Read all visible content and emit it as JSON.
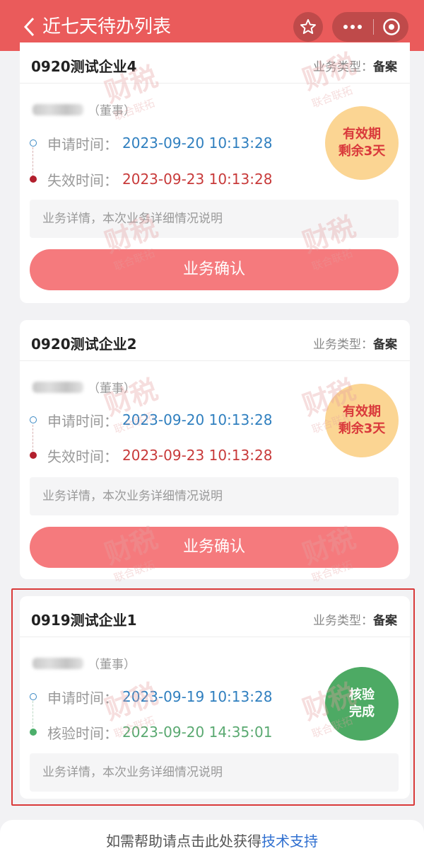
{
  "header": {
    "title": "近七天待办列表",
    "icons": {
      "back": "chevron-left-icon",
      "star": "star-icon",
      "more": "more-dots-icon",
      "close": "target-close-icon"
    },
    "accent": "#ea5b5b"
  },
  "cards": [
    {
      "company": "0920测试企业4",
      "type_label": "业务类型：",
      "type_value": "备案",
      "role": "（董事）",
      "apply_label": "申请时间：",
      "apply_time": "2023-09-20 10:13:28",
      "second_label": "失效时间：",
      "second_time": "2023-09-23 10:13:28",
      "badge_line1": "有效期",
      "badge_line2": "剩余3天",
      "detail": "业务详情，本次业务详细情况说明",
      "button": "业务确认"
    },
    {
      "company": "0920测试企业2",
      "type_label": "业务类型：",
      "type_value": "备案",
      "role": "（董事）",
      "apply_label": "申请时间：",
      "apply_time": "2023-09-20 10:13:28",
      "second_label": "失效时间：",
      "second_time": "2023-09-23 10:13:28",
      "badge_line1": "有效期",
      "badge_line2": "剩余3天",
      "detail": "业务详情，本次业务详细情况说明",
      "button": "业务确认"
    },
    {
      "company": "0919测试企业1",
      "type_label": "业务类型：",
      "type_value": "备案",
      "role": "（董事）",
      "apply_label": "申请时间：",
      "apply_time": "2023-09-19 10:13:28",
      "second_label": "核验时间：",
      "second_time": "2023-09-20 14:35:01",
      "badge_line1": "核验",
      "badge_line2": "完成",
      "detail": "业务详情，本次业务详细情况说明"
    }
  ],
  "footer": {
    "text": "如需帮助请点击此处获得",
    "link": "技术支持"
  },
  "watermark": {
    "main": "财税",
    "sub": "联合联拓"
  }
}
